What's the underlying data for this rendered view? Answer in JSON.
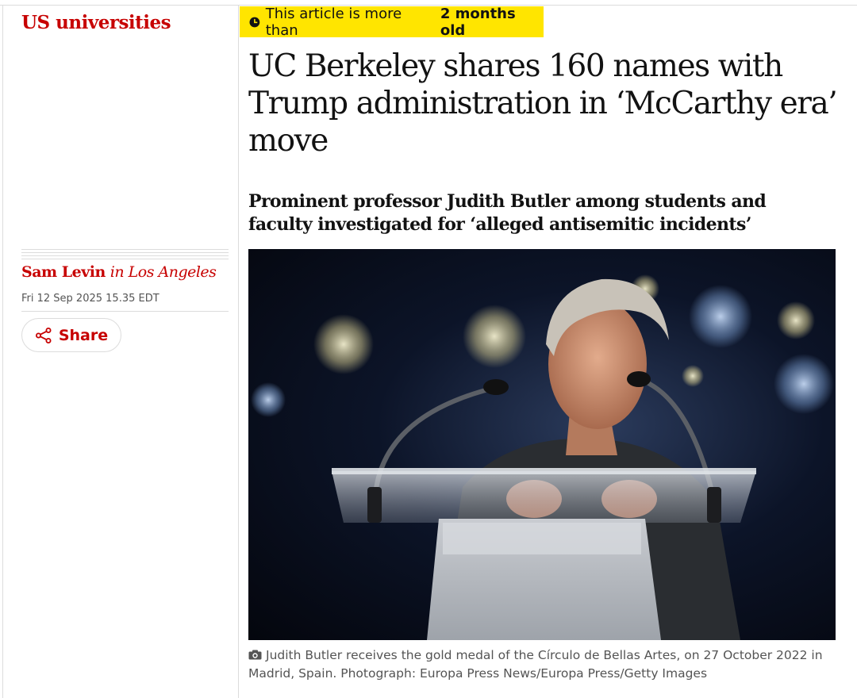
{
  "section": {
    "label": "US universities"
  },
  "age_warning": {
    "prefix": "This article is more than",
    "emphasis": "2 months old"
  },
  "headline": "UC Berkeley shares 160 names with Trump administration in ‘McCarthy era’ move",
  "standfirst": "Prominent professor Judith Butler among students and faculty investigated for ‘alleged antisemitic incidents’",
  "byline": {
    "author": "Sam Levin",
    "location": "in Los Angeles"
  },
  "dateline": "Fri 12 Sep 2025 15.35 EDT",
  "share": {
    "label": "Share",
    "icon": "share-icon"
  },
  "main_image": {
    "caption": "Judith Butler receives the gold medal of the Círculo de Bellas Artes, on 27 October 2022 in Madrid, Spain. Photograph: Europa Press News/Europa Press/Getty Images",
    "caption_icon": "camera-icon"
  },
  "colors": {
    "accent": "#c70000",
    "warning": "#ffe500",
    "text": "#121212",
    "muted": "#545454",
    "rule": "#dcdcdc"
  }
}
